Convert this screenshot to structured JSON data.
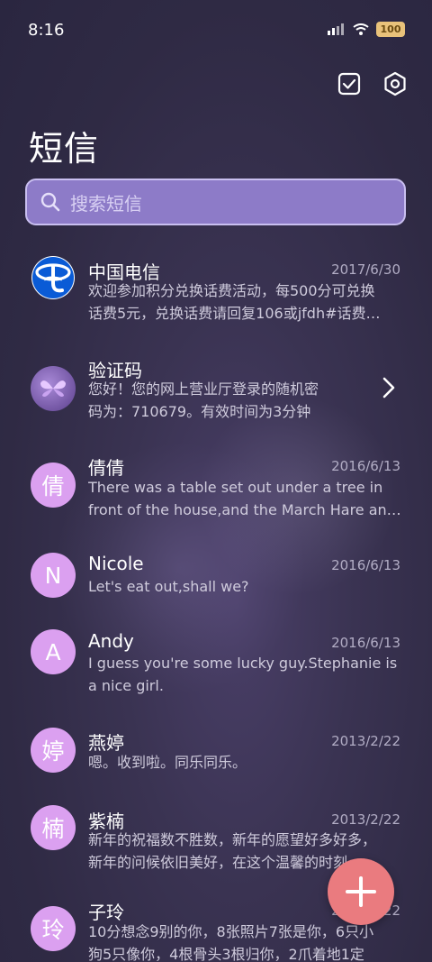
{
  "status_bar": {
    "time": "8:16",
    "battery": "100"
  },
  "header": {
    "title": "短信"
  },
  "search": {
    "placeholder": "搜索短信"
  },
  "conversations": [
    {
      "name": "中国电信",
      "date": "2017/6/30",
      "line1": "欢迎参加积分兑换话费活动，每500分可兑换",
      "line2": "话费5元，兑换话费请回复106或jfdh#话费…"
    },
    {
      "name": "验证码",
      "date": "",
      "line1": "您好！您的网上营业厅登录的随机密",
      "line2": "码为：710679。有效时间为3分钟"
    },
    {
      "name": "倩倩",
      "avatar": "倩",
      "date": "2016/6/13",
      "line1": "There was a table set out under a tree in",
      "line2": "front of the house,and the March Hare an…"
    },
    {
      "name": "Nicole",
      "avatar": "N",
      "date": "2016/6/13",
      "line1": "Let's eat out,shall we?",
      "line2": ""
    },
    {
      "name": "Andy",
      "avatar": "A",
      "date": "2016/6/13",
      "line1": "I guess you're some lucky guy.Stephanie is",
      "line2": "a nice girl."
    },
    {
      "name": "燕婷",
      "avatar": "婷",
      "date": "2013/2/22",
      "line1": "嗯。收到啦。同乐同乐。",
      "line2": ""
    },
    {
      "name": "紫楠",
      "avatar": "楠",
      "date": "2013/2/22",
      "line1": "新年的祝福数不胜数，新年的愿望好多好多，",
      "line2": "新年的问候依旧美好，在这个温馨的时刻…"
    },
    {
      "name": "子玲",
      "avatar": "玲",
      "date": "2013/2/22",
      "line1": "10分想念9别的你，8张照片7张是你，6只小",
      "line2": "狗5只像你，4根骨头3根归你，2爪着地1定"
    }
  ],
  "colors": {
    "avatar": "#dba0f0",
    "fab": "#ea7b7f",
    "search_bg": "#8d7bc8"
  }
}
